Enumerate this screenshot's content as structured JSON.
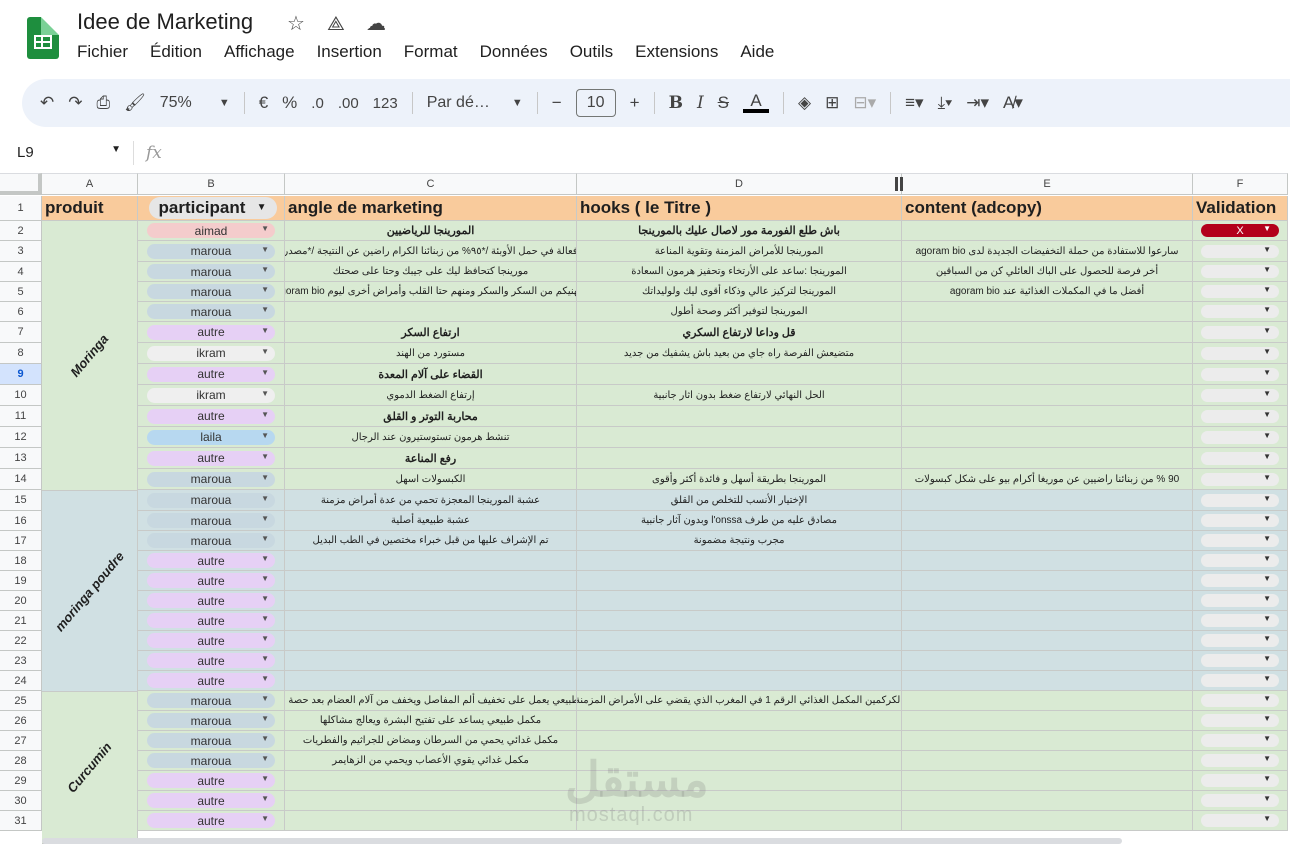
{
  "app": {
    "title": "Idee de Marketing",
    "menu": [
      "Fichier",
      "Édition",
      "Affichage",
      "Insertion",
      "Format",
      "Données",
      "Outils",
      "Extensions",
      "Aide"
    ]
  },
  "toolbar": {
    "zoom": "75%",
    "currency": "€",
    "percent": "%",
    "dec_decrease": ".0",
    "dec_increase": ".00",
    "number_format": "123",
    "font": "Par dé…",
    "font_size": "10",
    "text_color_label": "A"
  },
  "formula_bar": {
    "cell_ref": "L9",
    "fx": "fx",
    "value": ""
  },
  "columns": [
    "A",
    "B",
    "C",
    "D",
    "E",
    "F"
  ],
  "rows": [
    1,
    2,
    3,
    4,
    5,
    6,
    7,
    8,
    9,
    10,
    11,
    12,
    13,
    14,
    15,
    16,
    17,
    18,
    19,
    20,
    21,
    22,
    23,
    24,
    25,
    26,
    27,
    28,
    29,
    30,
    31
  ],
  "selected_row": 9,
  "headers": {
    "produit": "produit",
    "participant": "participant",
    "angle": "angle de marketing",
    "hooks": "hooks ( le Titre )",
    "content": "content (adcopy)",
    "validation": "Validation"
  },
  "products": [
    "Moringa",
    "moringa poudre",
    "Curcumin"
  ],
  "data_rows": [
    {
      "participant": "aimad",
      "angle": "المورينجا للرياضيين",
      "angle_bold": true,
      "hook": "باش طلع الفورمة مور لاصال عليك بالمورينجا",
      "hook_bold": true,
      "content": "",
      "validation": "X"
    },
    {
      "participant": "maroua",
      "angle": "فعالة في حمل الأوبئة /*٩٥% من زبنائنا الكرام راضين عن النتيجة /*مصدر",
      "hook": "المورينجا للأمراض المزمنة وتقوية المناعة",
      "content": "سارعوا للاستفادة من حملة التخفيضات الجديدة لدى agoram bio",
      "validation": ""
    },
    {
      "participant": "maroua",
      "angle": "مورينجا كتحافظ ليك على جيبك وحتا على صحتك",
      "hook": "المورينجا :ساعد على الأرتخاء وتحفيز هرمون السعادة",
      "content": "أخر فرصة للحصول على الباك العائلي كن من السباقين",
      "validation": ""
    },
    {
      "participant": "maroua",
      "angle": "كتهنيكم من السكر والسكر ومنهم حتا القلب وأمراض أخرى ليوم agoram bio",
      "hook": "المورينجا لتركيز عالي وذكاء أقوى ليك ولوليداتك",
      "content": "أفضل ما في المكملات الغذائية عند agoram bio",
      "validation": ""
    },
    {
      "participant": "maroua",
      "angle": "",
      "hook": "المورينجا لتوفير أكثر وصحة أطول",
      "content": "",
      "validation": ""
    },
    {
      "participant": "autre",
      "angle": "ارتفاع السكر",
      "angle_bold": true,
      "hook": "قل وداعا لارتفاع السكري",
      "hook_bold": true,
      "content": "",
      "validation": ""
    },
    {
      "participant": "ikram",
      "angle": "مستورد من الهند",
      "hook": "متضيعش الفرصة راه جاي من بعيد باش يشفيك من جديد",
      "content": "",
      "validation": ""
    },
    {
      "participant": "autre",
      "angle": "القضاء على آلام المعدة",
      "angle_bold": true,
      "hook": "",
      "content": "",
      "validation": ""
    },
    {
      "participant": "ikram",
      "angle": "إرتفاع الضغط الدموي",
      "hook": "الحل النهائي لارتفاع ضغط بدون اثار جانبية",
      "content": "",
      "validation": ""
    },
    {
      "participant": "autre",
      "angle": "محاربة التوتر و القلق",
      "angle_bold": true,
      "hook": "",
      "content": "",
      "validation": ""
    },
    {
      "participant": "laila",
      "angle": "تنشط هرمون تستوستيرون عند الرجال",
      "hook": "",
      "content": "",
      "validation": ""
    },
    {
      "participant": "autre",
      "angle": "رفع المناعة",
      "angle_bold": true,
      "hook": "",
      "content": "",
      "validation": ""
    },
    {
      "participant": "maroua",
      "angle": "الكبسولات اسهل",
      "hook": "المورينجا بطريقة أسهل و فائدة أكثر وأقوى",
      "content": "90 % من زبنائنا راضيين عن موريغا أكرام بيو على شكل كبسولات",
      "validation": ""
    },
    {
      "participant": "maroua",
      "angle": "عشبة المورينجا المعجزة تحمي من عدة أمراض مزمنة",
      "hook": "الإختيار الأنسب للتخلص من القلق",
      "content": "",
      "validation": ""
    },
    {
      "participant": "maroua",
      "angle": "عشبة طبيعية أصلية",
      "hook": "مصادق عليه من طرف l'onssa وبدون آثار جانبية",
      "content": "",
      "validation": ""
    },
    {
      "participant": "maroua",
      "angle": "تم الإشراف عليها من قبل خبراء مختصين في الطب البديل",
      "hook": "مجرب ونتيجة مضمونة",
      "content": "",
      "validation": ""
    },
    {
      "participant": "autre",
      "angle": "",
      "hook": "",
      "content": "",
      "validation": ""
    },
    {
      "participant": "autre",
      "angle": "",
      "hook": "",
      "content": "",
      "validation": ""
    },
    {
      "participant": "autre",
      "angle": "",
      "hook": "",
      "content": "",
      "validation": ""
    },
    {
      "participant": "autre",
      "angle": "",
      "hook": "",
      "content": "",
      "validation": ""
    },
    {
      "participant": "autre",
      "angle": "",
      "hook": "",
      "content": "",
      "validation": ""
    },
    {
      "participant": "autre",
      "angle": "",
      "hook": "",
      "content": "",
      "validation": ""
    },
    {
      "participant": "autre",
      "angle": "",
      "hook": "",
      "content": "",
      "validation": ""
    },
    {
      "participant": "maroua",
      "angle": "مكمل طبيعي يعمل على تخفيف ألم المفاصل ويخفف من آلام العضام بعد حصة الرياضة",
      "hook": "الكركمين المكمل الغذائي الرقم 1 في المغرب الذي يقضي على الأمراض المزمنة",
      "content": "",
      "validation": ""
    },
    {
      "participant": "maroua",
      "angle": "مكمل طبيعي يساعد على تفتيح البشرة ويعالج مشاكلها",
      "hook": "",
      "content": "",
      "validation": ""
    },
    {
      "participant": "maroua",
      "angle": "مكمل غدائي يحمي من السرطان ومضاض للجراثيم والفطريات",
      "hook": "",
      "content": "",
      "validation": ""
    },
    {
      "participant": "maroua",
      "angle": "مكمل غدائي يقوي الأعصاب ويحمي من الزهايمر",
      "hook": "",
      "content": "",
      "validation": ""
    },
    {
      "participant": "autre",
      "angle": "",
      "hook": "",
      "content": "",
      "validation": ""
    },
    {
      "participant": "autre",
      "angle": "",
      "hook": "",
      "content": "",
      "validation": ""
    },
    {
      "participant": "autre",
      "angle": "",
      "hook": "",
      "content": "",
      "validation": ""
    }
  ],
  "watermark": {
    "main": "مستقل",
    "sub": "mostaql.com"
  },
  "colors": {
    "header": "#f9cb9c",
    "green": "#d9ead3",
    "blue": "#d0e0e3",
    "x_chip": "#b3001b",
    "accent": "#0b57d0"
  }
}
